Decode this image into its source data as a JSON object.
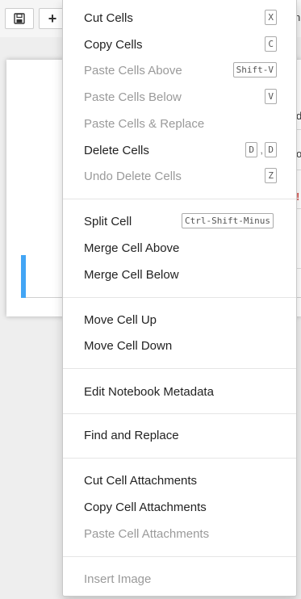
{
  "toolbar": {
    "plus_label": "+",
    "right_fragment": "n"
  },
  "side_fragments": [
    {
      "text": "d",
      "red": false
    },
    {
      "text": "o",
      "red": false
    },
    {
      "text": "!",
      "red": true
    }
  ],
  "menu": {
    "cut_cells": {
      "label": "Cut Cells",
      "shortcut": "X"
    },
    "copy_cells": {
      "label": "Copy Cells",
      "shortcut": "C"
    },
    "paste_above": {
      "label": "Paste Cells Above",
      "shortcut": "Shift-V"
    },
    "paste_below": {
      "label": "Paste Cells Below",
      "shortcut": "V"
    },
    "paste_replace": {
      "label": "Paste Cells & Replace"
    },
    "delete_cells": {
      "label": "Delete Cells",
      "shortcut_a": "D",
      "comma": ",",
      "shortcut_b": "D"
    },
    "undo_delete": {
      "label": "Undo Delete Cells",
      "shortcut": "Z"
    },
    "split_cell": {
      "label": "Split Cell",
      "shortcut": "Ctrl-Shift-Minus"
    },
    "merge_above": {
      "label": "Merge Cell Above"
    },
    "merge_below": {
      "label": "Merge Cell Below"
    },
    "move_up": {
      "label": "Move Cell Up"
    },
    "move_down": {
      "label": "Move Cell Down"
    },
    "edit_metadata": {
      "label": "Edit Notebook Metadata"
    },
    "find_replace": {
      "label": "Find and Replace"
    },
    "cut_attachments": {
      "label": "Cut Cell Attachments"
    },
    "copy_attachments": {
      "label": "Copy Cell Attachments"
    },
    "paste_attachments": {
      "label": "Paste Cell Attachments"
    },
    "insert_image": {
      "label": "Insert Image"
    }
  }
}
